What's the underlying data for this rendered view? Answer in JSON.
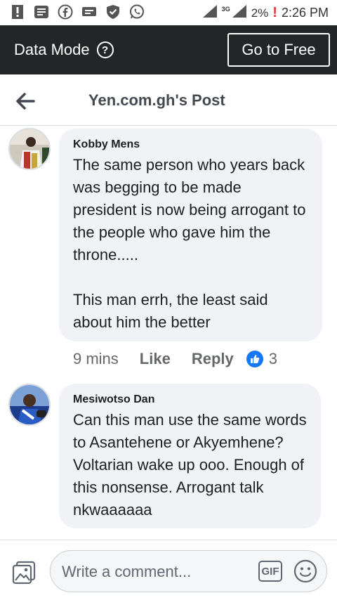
{
  "status_bar": {
    "network": "3G",
    "battery": "2%",
    "battery_alert": "!",
    "time": "2:26 PM",
    "icons": [
      "notification-icon",
      "message-icon",
      "facebook-icon",
      "chat-icon",
      "shield-icon",
      "whatsapp-icon",
      "signal-icon",
      "battery-icon"
    ]
  },
  "data_mode": {
    "label": "Data Mode",
    "info": "?",
    "button": "Go to Free"
  },
  "header": {
    "title": "Yen.com.gh's Post"
  },
  "comments": [
    {
      "author": "Kobby Mens",
      "text": "The same person who years back was begging to be made president is now being arrogant to the people who gave him the throne.....\n\nThis man errh, the least said about him the better",
      "time": "9 mins",
      "like": "Like",
      "reply": "Reply",
      "reactions": "3"
    },
    {
      "author": "Mesiwotso Dan",
      "text": "Can this man use the same words to Asantehene or Akyemhene? Voltarian wake up ooo. Enough of this nonsense. Arrogant talk nkwaaaaaa"
    }
  ],
  "composer": {
    "placeholder": "Write a comment...",
    "gif": "GIF"
  },
  "colors": {
    "data_bar": "#242526",
    "bubble": "#f0f2f5",
    "accent": "#1877f2"
  }
}
